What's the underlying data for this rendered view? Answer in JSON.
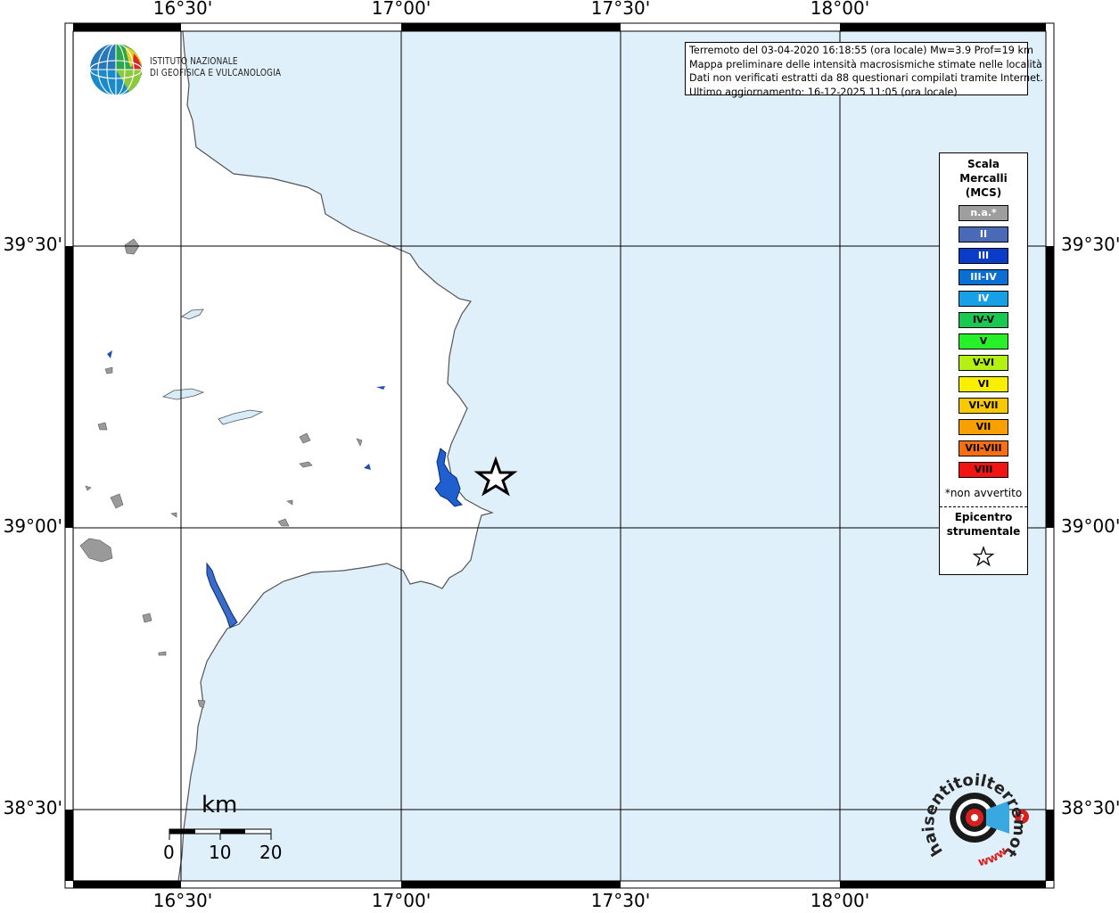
{
  "map": {
    "top_labels": [
      "16°30'",
      "17°00'",
      "17°30'",
      "18°00'"
    ],
    "bottom_labels": [
      "16°30'",
      "17°00'",
      "17°30'",
      "18°00'"
    ],
    "left_labels": [
      "39°30'",
      "39°00'",
      "38°30'"
    ],
    "right_labels": [
      "39°30'",
      "39°00'",
      "38°30'"
    ],
    "colors": {
      "sea": "#dff0fb",
      "land": "#ffffff",
      "lake": "#d8ecf8",
      "coast": "#555555",
      "grid": "#000000",
      "reservoir": "#1f5fd0",
      "town": "#9a9a9a"
    }
  },
  "info": {
    "line1": "Terremoto del 03-04-2020 16:18:55 (ora locale) Mw=3.9 Prof=19 km",
    "line2": "Mappa preliminare delle intensità macrosismiche stimate nelle località",
    "line3": "Dati non verificati estratti da 88 questionari compilati tramite Internet.",
    "line4": "Ultimo aggiornamento: 16-12-2025 11:05 (ora locale)"
  },
  "logo": {
    "line1": "ISTITUTO NAZIONALE",
    "line2": "DI GEOFISICA E VULCANOLOGIA"
  },
  "legend": {
    "title1": "Scala",
    "title2": "Mercalli",
    "title3": "(MCS)",
    "items": [
      {
        "label": "n.a.*",
        "color": "#9e9e9e",
        "text_color": "#ffffff"
      },
      {
        "label": "II",
        "color": "#4a6ab8",
        "text_color": "#ffffff"
      },
      {
        "label": "III",
        "color": "#0a3cc8",
        "text_color": "#ffffff"
      },
      {
        "label": "III-IV",
        "color": "#0a6ed2",
        "text_color": "#ffffff"
      },
      {
        "label": "IV",
        "color": "#18a0e6",
        "text_color": "#ffffff"
      },
      {
        "label": "IV-V",
        "color": "#18c850",
        "text_color": "#000000"
      },
      {
        "label": "V",
        "color": "#28f028",
        "text_color": "#000000"
      },
      {
        "label": "V-VI",
        "color": "#b4f014",
        "text_color": "#000000"
      },
      {
        "label": "VI",
        "color": "#f8f000",
        "text_color": "#000000"
      },
      {
        "label": "VI-VII",
        "color": "#f8c800",
        "text_color": "#000000"
      },
      {
        "label": "VII",
        "color": "#f8a000",
        "text_color": "#000000"
      },
      {
        "label": "VII-VIII",
        "color": "#f86e14",
        "text_color": "#000000"
      },
      {
        "label": "VIII",
        "color": "#f01414",
        "text_color": "#000000"
      }
    ],
    "note": "*non avvertito",
    "epicenter1": "Epicentro",
    "epicenter2": "strumentale"
  },
  "scale_bar": {
    "unit": "km",
    "ticks": [
      "0",
      "10",
      "20"
    ]
  },
  "hsit_logo": {
    "text": "haisentitoilterremoto.it",
    "prefix": "www."
  }
}
